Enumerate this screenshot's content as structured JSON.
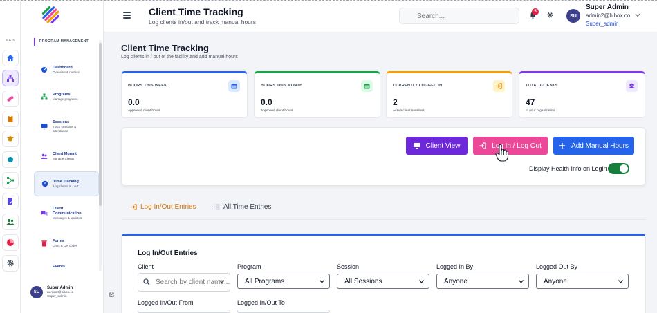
{
  "header": {
    "title": "Client Time Tracking",
    "subtitle": "Log clients in/out and track manual hours",
    "search_placeholder": "Search...",
    "notification_count": "5",
    "user": {
      "initials": "SU",
      "name": "Super Admin",
      "email": "admin2@hibox.co",
      "role": "Super_admin"
    }
  },
  "rail": {
    "label": "MAIN",
    "items": [
      {
        "icon": "home-icon",
        "color": "#2563eb"
      },
      {
        "icon": "sitemap-icon",
        "color": "#7c3aed"
      },
      {
        "icon": "pill-icon",
        "color": "#ec4899"
      },
      {
        "icon": "clipboard-icon",
        "color": "#d97706"
      },
      {
        "icon": "graduation-cap-icon",
        "color": "#ca8a04"
      },
      {
        "icon": "circle-icon",
        "color": "#0891b2"
      },
      {
        "icon": "network-icon",
        "color": "#16a34a"
      },
      {
        "icon": "file-edit-icon",
        "color": "#4f46e5"
      },
      {
        "icon": "users-icon",
        "color": "#15803d"
      },
      {
        "icon": "pie-chart-icon",
        "color": "#e11d48"
      },
      {
        "icon": "gear-icon",
        "color": "#4b5563"
      }
    ]
  },
  "nav": {
    "section": "PROGRAM MANAGEMENT",
    "items": [
      {
        "title": "Dashboard",
        "sub": "Overview & metrics"
      },
      {
        "title": "Programs",
        "sub": "Manage programs"
      },
      {
        "title": "Sessions",
        "sub": "Track sessions &",
        "sub2": "attendance"
      },
      {
        "title": "Client Mgmnt",
        "sub": "Manage Clients"
      },
      {
        "title": "Time Tracking",
        "sub": "Log clients in / out"
      },
      {
        "title": "Client",
        "title2": "Communication",
        "sub": "Messages & updates"
      },
      {
        "title": "Forms",
        "sub": "Links & QR codes"
      },
      {
        "title": "Events"
      }
    ],
    "footer_user": {
      "initials": "SU",
      "name": "Super Admin",
      "email": "admin2@hibox.co",
      "role": "Super_admin"
    }
  },
  "page": {
    "title": "Client Time Tracking",
    "subtitle": "Log clients in / out of the facility and add manual hours"
  },
  "stats": [
    {
      "label": "HOURS THIS WEEK",
      "value": "0.0",
      "note": "Approved client hours",
      "color": "#2563eb"
    },
    {
      "label": "HOURS THIS MONTH",
      "value": "0.0",
      "note": "Approved client hours",
      "color": "#16a34a"
    },
    {
      "label": "CURRENTLY LOGGED IN",
      "value": "2",
      "note": "Active client sessions",
      "color": "#f59e0b"
    },
    {
      "label": "TOTAL CLIENTS",
      "value": "47",
      "note": "In your organization",
      "color": "#7c3aed"
    }
  ],
  "actions": {
    "client_view": "Client View",
    "log_in_out": "Log In / Log Out",
    "add_manual": "Add Manual Hours",
    "health_label": "Display Health Info on Login",
    "health_on": true
  },
  "tabs": [
    {
      "label": "Log In/Out Entries",
      "active": true
    },
    {
      "label": "All Time Entries",
      "active": false
    }
  ],
  "entries": {
    "title": "Log In/Out Entries",
    "filters": {
      "client_label": "Client",
      "client_placeholder": "Search by client name...",
      "program_label": "Program",
      "program_value": "All Programs",
      "session_label": "Session",
      "session_value": "All Sessions",
      "logged_in_by_label": "Logged In By",
      "logged_in_by_value": "Anyone",
      "logged_out_by_label": "Logged Out By",
      "logged_out_by_value": "Anyone",
      "from_label": "Logged In/Out From",
      "to_label": "Logged In/Out To"
    }
  }
}
